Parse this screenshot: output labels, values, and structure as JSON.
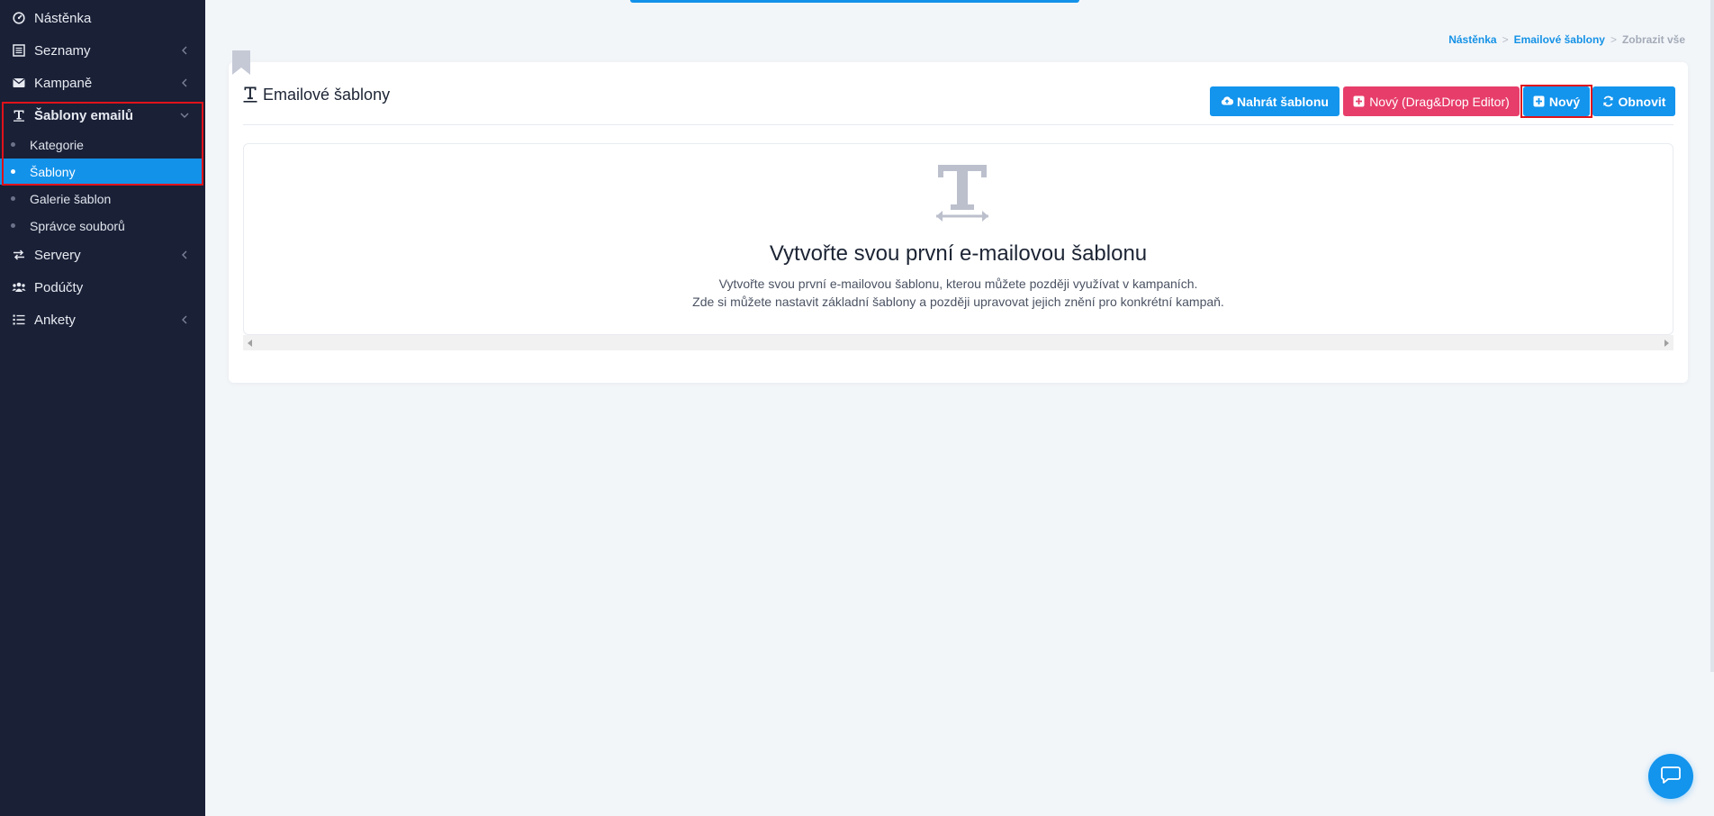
{
  "sidebar": {
    "items": [
      {
        "label": "Nástěnka",
        "icon": "dashboard-icon"
      },
      {
        "label": "Seznamy",
        "icon": "list-icon"
      },
      {
        "label": "Kampaně",
        "icon": "envelope-icon"
      },
      {
        "label": "Šablony emailů",
        "icon": "text-template-icon"
      },
      {
        "label": "Servery",
        "icon": "exchange-icon"
      },
      {
        "label": "Podúčty",
        "icon": "users-icon"
      },
      {
        "label": "Ankety",
        "icon": "poll-list-icon"
      }
    ],
    "sub_items": [
      {
        "label": "Kategorie"
      },
      {
        "label": "Šablony"
      },
      {
        "label": "Galerie šablon"
      },
      {
        "label": "Správce souborů"
      }
    ]
  },
  "breadcrumb": {
    "home": "Nástěnka",
    "section": "Emailové šablony",
    "current": "Zobrazit vše",
    "separator": ">"
  },
  "card": {
    "title": "Emailové šablony",
    "buttons": {
      "upload": "Nahrát šablonu",
      "new_dnd": "Nový (Drag&Drop Editor)",
      "new": "Nový",
      "refresh": "Obnovit"
    },
    "empty": {
      "title": "Vytvořte svou první e-mailovou šablonu",
      "line1": "Vytvořte svou první e-mailovou šablonu, kterou můžete později využívat v kampaních.",
      "line2": "Zde si můžete nastavit základní šablony a později upravovat jejich znění pro konkrétní kampaň."
    }
  },
  "colors": {
    "sidebar_bg": "#1a2036",
    "accent_blue": "#1394ed",
    "pink": "#e73d6a",
    "highlight_red": "#e0121a"
  }
}
